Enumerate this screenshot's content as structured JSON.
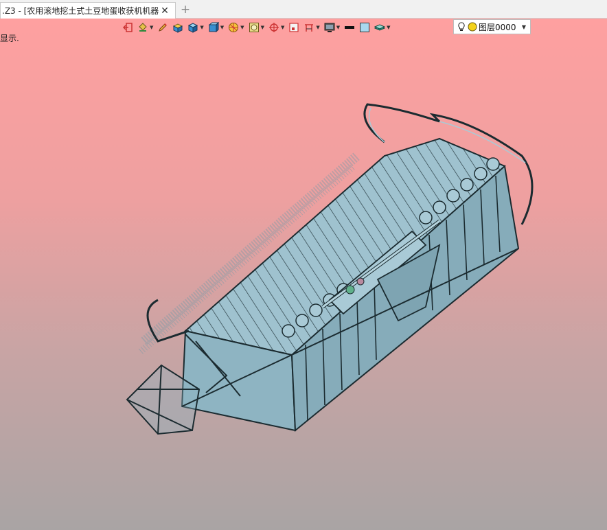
{
  "tab": {
    "title": ".Z3 - [农用滚地挖土式土豆地蛋收获机机器]",
    "close_symbol": "✕",
    "new_symbol": "+"
  },
  "viewport": {
    "hint_text": "显示.",
    "bg_top": "#fea0a0",
    "bg_bottom": "#a9a4a4"
  },
  "toolbar": {
    "layer_name": "图层0000",
    "layer_arrow": "▼",
    "icons": [
      "exit-sketch-icon",
      "paint-bucket-icon",
      "pencil-icon",
      "box-shaded-icon",
      "cube-icon",
      "cube-cut-icon",
      "sphere-render-icon",
      "display-filter-icon",
      "target-icon",
      "frame-icon",
      "dimension-icon",
      "monitor-icon",
      "line-style-icon",
      "color-swatch-icon",
      "layer-stack-icon",
      "lightbulb-icon",
      "layer-status-icon"
    ]
  },
  "colors": {
    "model_fill": "#8eb4c2",
    "model_light": "#a9cad6",
    "model_dark": "#5f8694",
    "edge": "#1b2b30"
  }
}
